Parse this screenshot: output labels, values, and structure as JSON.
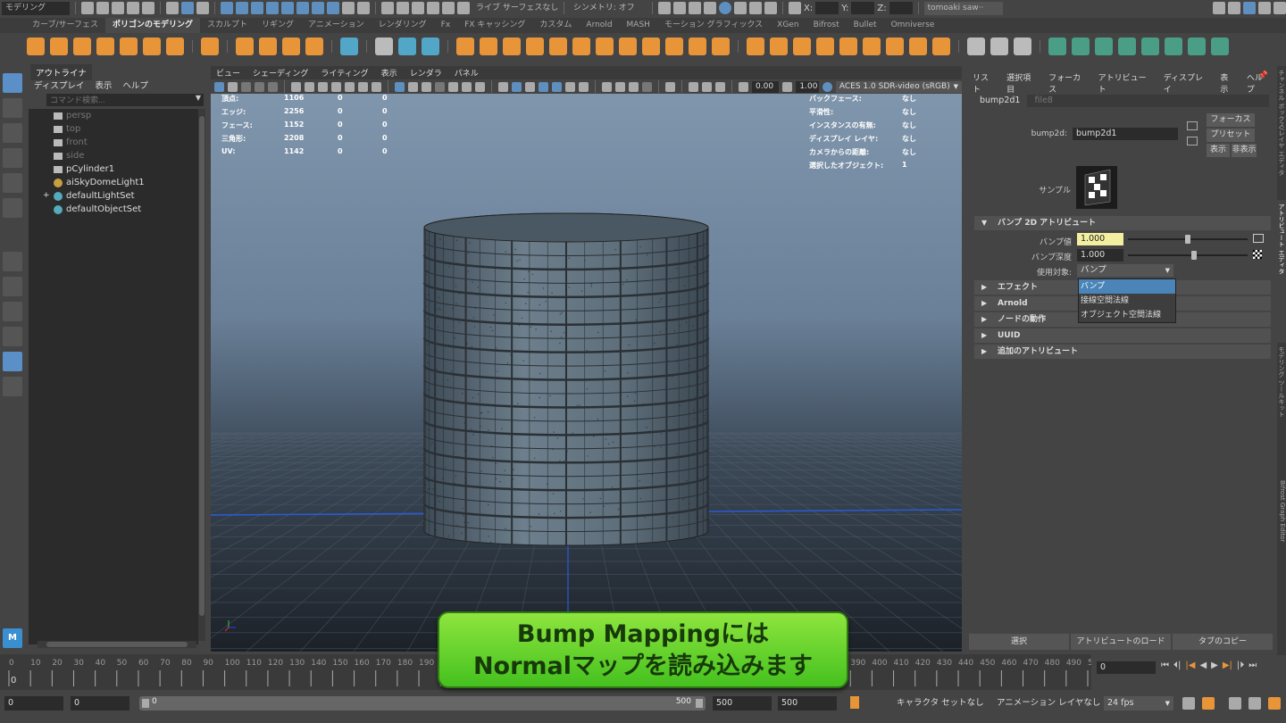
{
  "statusline": {
    "mode": "モデリング",
    "live": "ライブ サーフェスなし",
    "symmetry": "シンメトリ: オフ",
    "x": "X:",
    "y": "Y:",
    "z": "Z:",
    "user": "tomoaki saw··"
  },
  "shelf_tabs": [
    "カーブ/サーフェス",
    "ポリゴンのモデリング",
    "スカルプト",
    "リギング",
    "アニメーション",
    "レンダリング",
    "Fx",
    "FX キャッシング",
    "カスタム",
    "Arnold",
    "MASH",
    "モーション グラフィックス",
    "XGen",
    "Bifrost",
    "Bullet",
    "Omniverse"
  ],
  "shelf_active": 1,
  "outliner": {
    "tab": "アウトライナ",
    "menu": [
      "ディスプレイ",
      "表示",
      "ヘルプ"
    ],
    "search_placeholder": "コマンド検索...",
    "items": [
      {
        "label": "persp",
        "dim": true,
        "icon": "camera-icon"
      },
      {
        "label": "top",
        "dim": true,
        "icon": "camera-icon"
      },
      {
        "label": "front",
        "dim": true,
        "icon": "camera-icon"
      },
      {
        "label": "side",
        "dim": true,
        "icon": "camera-icon"
      },
      {
        "label": "pCylinder1",
        "icon": "mesh-icon"
      },
      {
        "label": "aiSkyDomeLight1",
        "icon": "dome-light-icon"
      },
      {
        "label": "defaultLightSet",
        "icon": "set-icon",
        "expand": "+"
      },
      {
        "label": "defaultObjectSet",
        "icon": "set-icon"
      }
    ]
  },
  "viewport": {
    "menu": [
      "ビュー",
      "シェーディング",
      "ライティング",
      "表示",
      "レンダラ",
      "パネル"
    ],
    "exposure": "0.00",
    "gamma": "1.00",
    "colorspace": "ACES 1.0 SDR-video (sRGB)",
    "hud_left": [
      [
        "頂点:",
        "1106",
        "0",
        "0"
      ],
      [
        "エッジ:",
        "2256",
        "0",
        "0"
      ],
      [
        "フェース:",
        "1152",
        "0",
        "0"
      ],
      [
        "三角形:",
        "2208",
        "0",
        "0"
      ],
      [
        "UV:",
        "1142",
        "0",
        "0"
      ]
    ],
    "hud_right": [
      [
        "バックフェース:",
        "なし"
      ],
      [
        "平滑性:",
        "なし"
      ],
      [
        "インスタンスの有無:",
        "なし"
      ],
      [
        "ディスプレイ レイヤ:",
        "なし"
      ],
      [
        "カメラからの距離:",
        "なし"
      ],
      [
        "選択したオブジェクト:",
        "1"
      ]
    ]
  },
  "attribute_editor": {
    "menu": [
      "リスト",
      "選択項目",
      "フォーカス",
      "アトリビュート",
      "ディスプレイ",
      "表示",
      "ヘルプ"
    ],
    "tabs": [
      "bump2d1",
      "file8"
    ],
    "node_label": "bump2d:",
    "node_name": "bump2d1",
    "focus": "フォーカス",
    "preset": "プリセット",
    "show": "表示",
    "hide": "非表示",
    "sample": "サンプル",
    "section_bump": "バンプ 2D アトリビュート",
    "bump_value_label": "バンプ値",
    "bump_value": "1.000",
    "bump_value_level": 0.5,
    "bump_depth_label": "バンプ深度",
    "bump_depth": "1.000",
    "bump_depth_level": 0.55,
    "use_as_label": "使用対象:",
    "use_as": "バンプ",
    "use_as_options": [
      "バンプ",
      "接線空間法線",
      "オブジェクト空間法線"
    ],
    "sections": [
      "エフェクト",
      "Arnold",
      "ノードの動作",
      "UUID",
      "追加のアトリビュート"
    ],
    "footer": [
      "選択",
      "アトリビュートのロード",
      "タブのコピー"
    ]
  },
  "side_tabs": [
    "チャンネル ボックス/レイヤ エディタ",
    "アトリビュート エディタ",
    "モデリング ツールキット",
    "Bifrost Graph Editor"
  ],
  "timeline": {
    "start": 0,
    "end": 500,
    "step": 10,
    "current": "0",
    "current_frame_field": "0"
  },
  "range": {
    "start": "0",
    "anim_start": "0",
    "slider_start": "0",
    "slider_end": "500",
    "anim_end": "500",
    "end": "500",
    "character_set": "キャラクタ セットなし",
    "anim_layer": "アニメーション レイヤなし",
    "fps": "24 fps"
  },
  "caption": {
    "line1": "Bump Mappingには",
    "line2": "Normalマップを読み込みます"
  },
  "colors": {
    "accent": "#5a8fc7",
    "shelf_icon": "#e8953a",
    "caption_green": "#5fd12a",
    "highlight_field": "#f3efa0"
  }
}
